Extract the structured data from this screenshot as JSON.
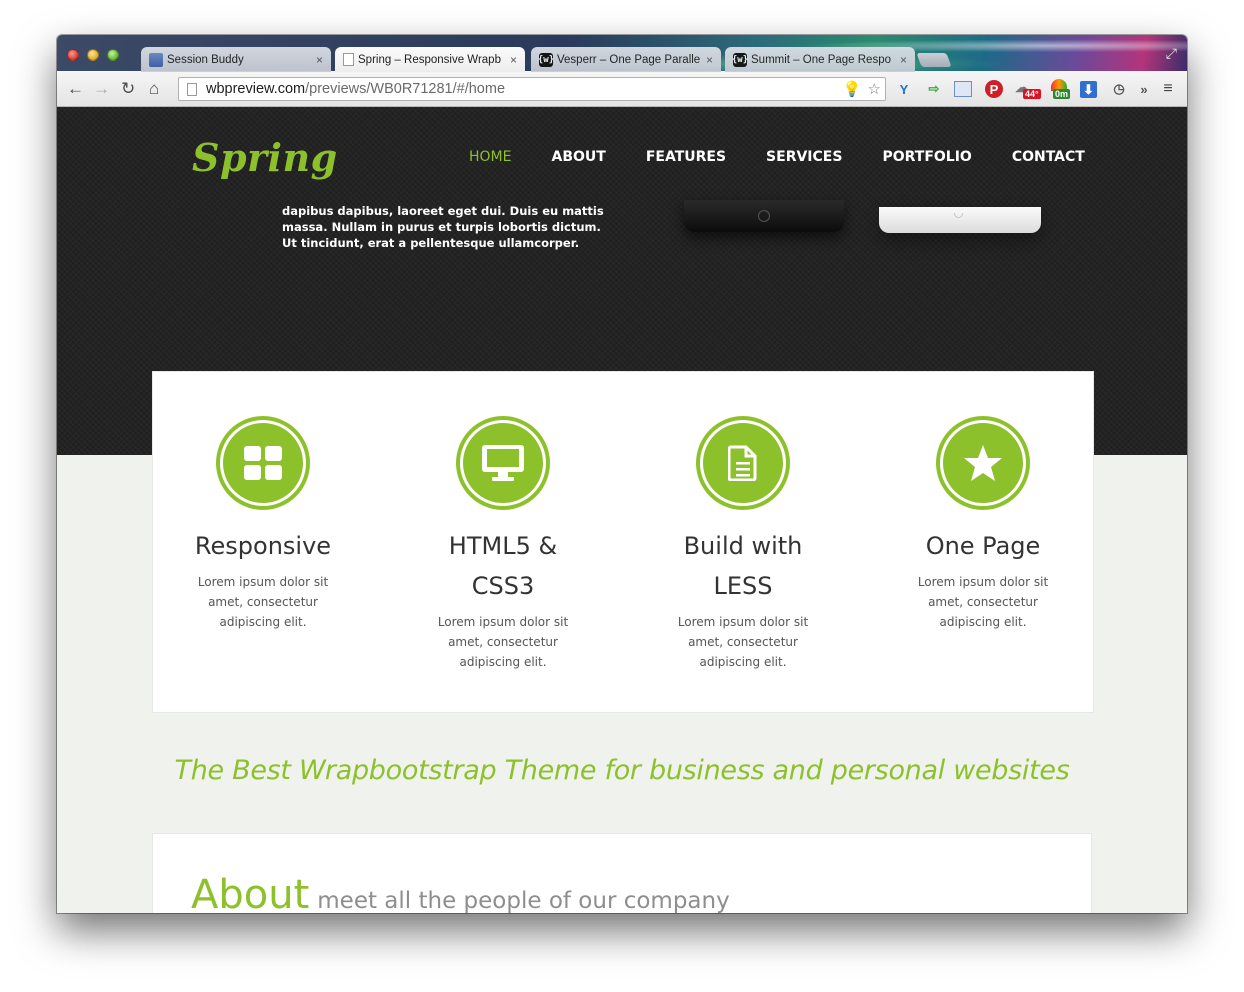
{
  "browser": {
    "tabs": [
      {
        "title": "Session Buddy",
        "favicon": "session-buddy-icon"
      },
      {
        "title": "Spring – Responsive Wrapb",
        "favicon": "page-icon",
        "active": true
      },
      {
        "title": "Vesperr – One Page Paralle",
        "favicon": "wrapbootstrap-icon"
      },
      {
        "title": "Summit – One Page Respo",
        "favicon": "wrapbootstrap-icon"
      }
    ],
    "close_glyph": "×",
    "url_host": "wbpreview.com",
    "url_path": "/previews/WB0R71281/#/home",
    "badges": {
      "weather": "44°",
      "timer": "0m"
    }
  },
  "site": {
    "logo": "Spring",
    "brand_color": "#8dc12c",
    "nav": [
      "HOME",
      "ABOUT",
      "FEATURES",
      "SERVICES",
      "PORTFOLIO",
      "CONTACT"
    ],
    "hero_text": "dapibus dapibus, laoreet eget dui. Duis eu mattis massa. Nullam in purus et turpis lobortis dictum. Ut tincidunt, erat a pellentesque ullamcorper.",
    "features": [
      {
        "title": "Responsive",
        "desc": "Lorem ipsum dolor sit amet, consectetur adipiscing elit.",
        "icon": "grid-icon"
      },
      {
        "title": "HTML5 & CSS3",
        "desc": "Lorem ipsum dolor sit amet, consectetur adipiscing elit.",
        "icon": "monitor-icon"
      },
      {
        "title": "Build with LESS",
        "desc": "Lorem ipsum dolor sit amet, consectetur adipiscing elit.",
        "icon": "document-icon"
      },
      {
        "title": "One Page",
        "desc": "Lorem ipsum dolor sit amet, consectetur adipiscing elit.",
        "icon": "star-icon"
      }
    ],
    "tagline": "The Best Wrapbootstrap Theme for business and personal websites",
    "about": {
      "title": "About",
      "subtitle": "meet all the people of our company"
    }
  }
}
